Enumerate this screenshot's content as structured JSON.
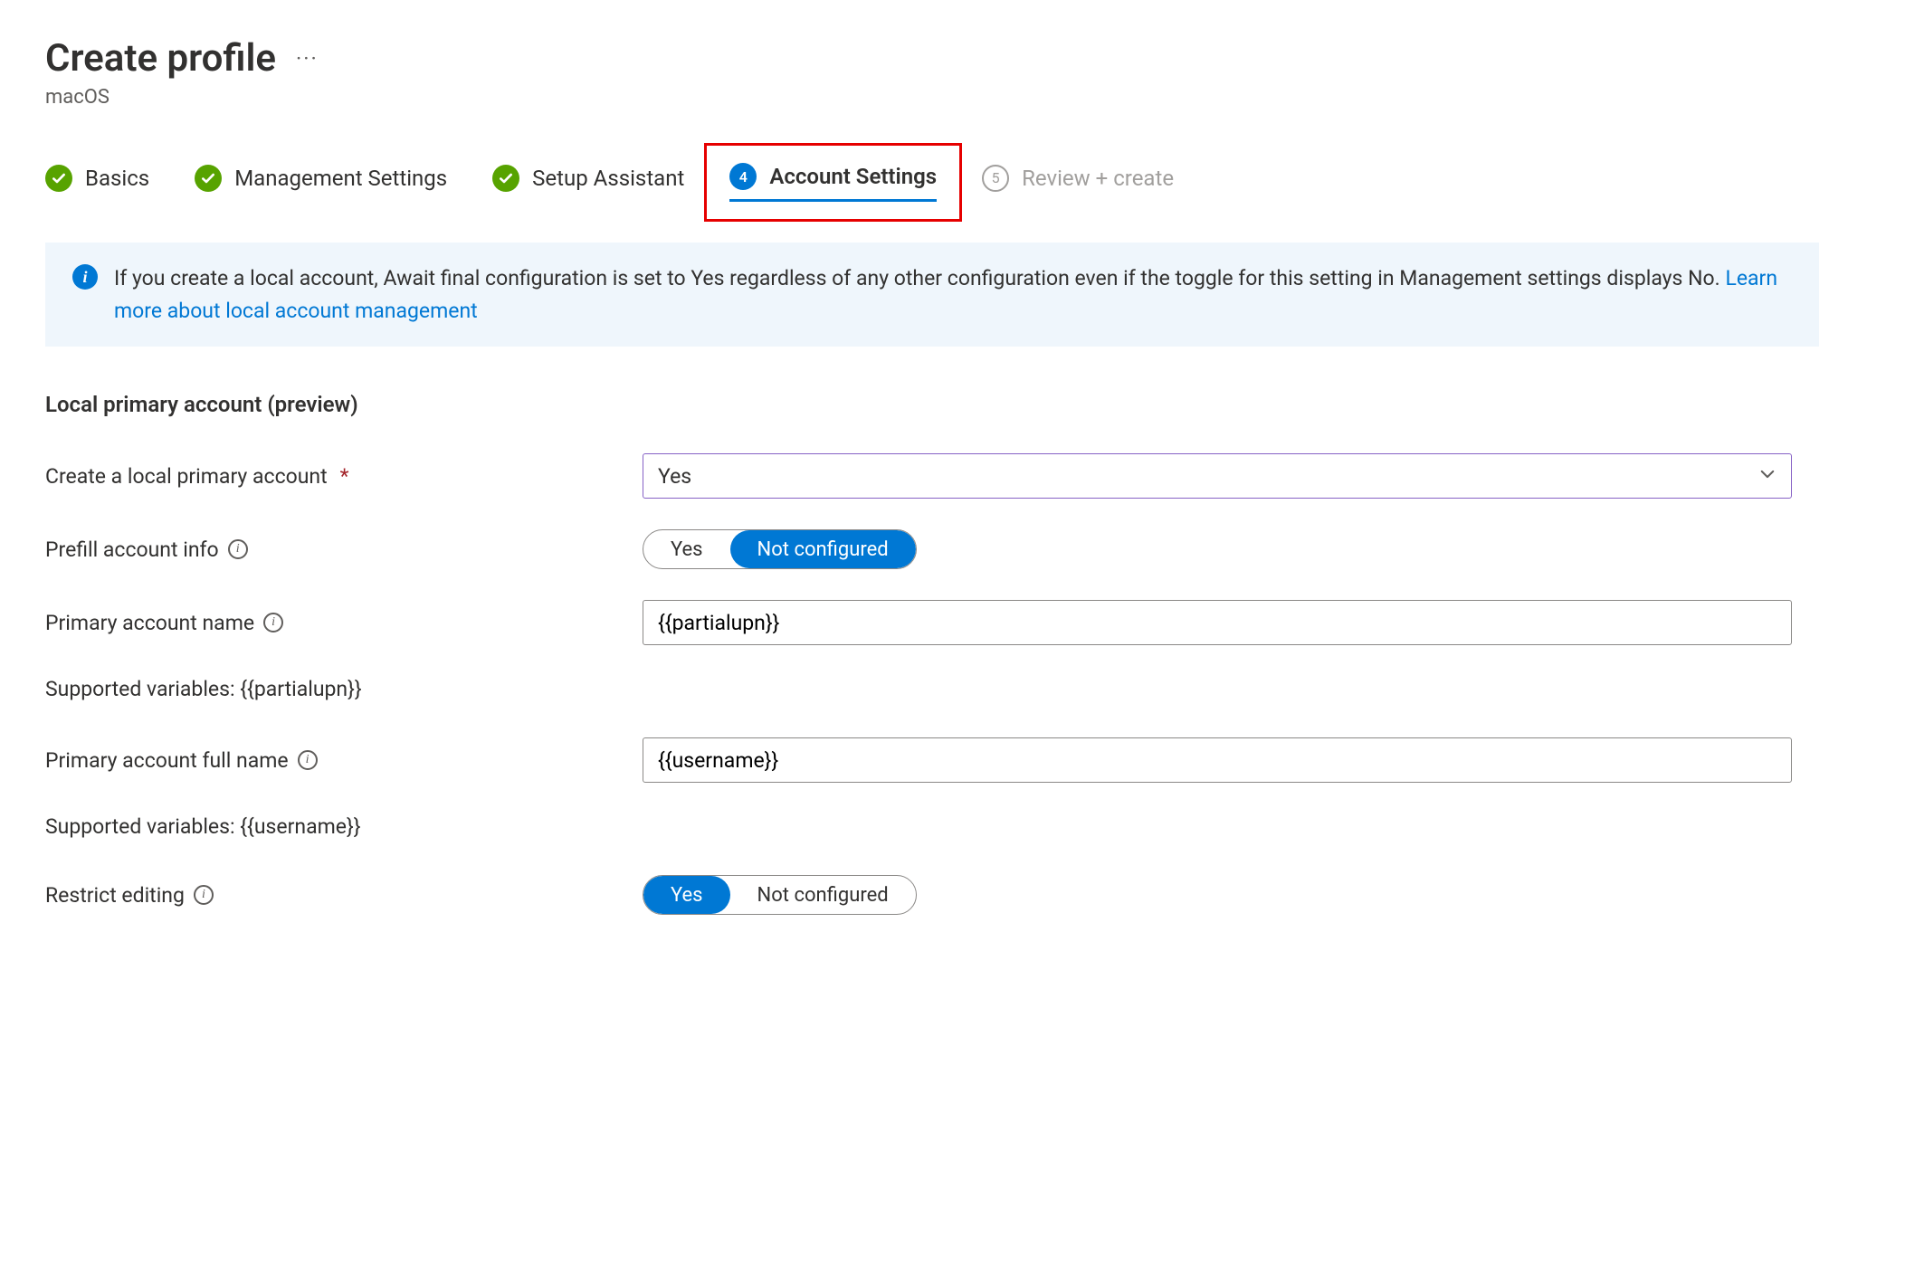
{
  "header": {
    "title": "Create profile",
    "subtitle": "macOS"
  },
  "steps": {
    "s1": "Basics",
    "s2": "Management Settings",
    "s3": "Setup Assistant",
    "s4_num": "4",
    "s4": "Account Settings",
    "s5_num": "5",
    "s5": "Review + create"
  },
  "banner": {
    "text": "If you create a local account, Await final configuration is set to Yes regardless of any other configuration even if the toggle for this setting in Management settings displays No. ",
    "link": "Learn more about local account management"
  },
  "section": {
    "title": "Local primary account (preview)"
  },
  "form": {
    "create_local": {
      "label": "Create a local primary account",
      "value": "Yes"
    },
    "prefill": {
      "label": "Prefill account info",
      "opt_yes": "Yes",
      "opt_no": "Not configured"
    },
    "account_name": {
      "label": "Primary account name",
      "value": "{{partialupn}}",
      "hint": "Supported variables: {{partialupn}}"
    },
    "full_name": {
      "label": "Primary account full name",
      "value": "{{username}}",
      "hint": "Supported variables: {{username}}"
    },
    "restrict": {
      "label": "Restrict editing",
      "opt_yes": "Yes",
      "opt_no": "Not configured"
    }
  }
}
